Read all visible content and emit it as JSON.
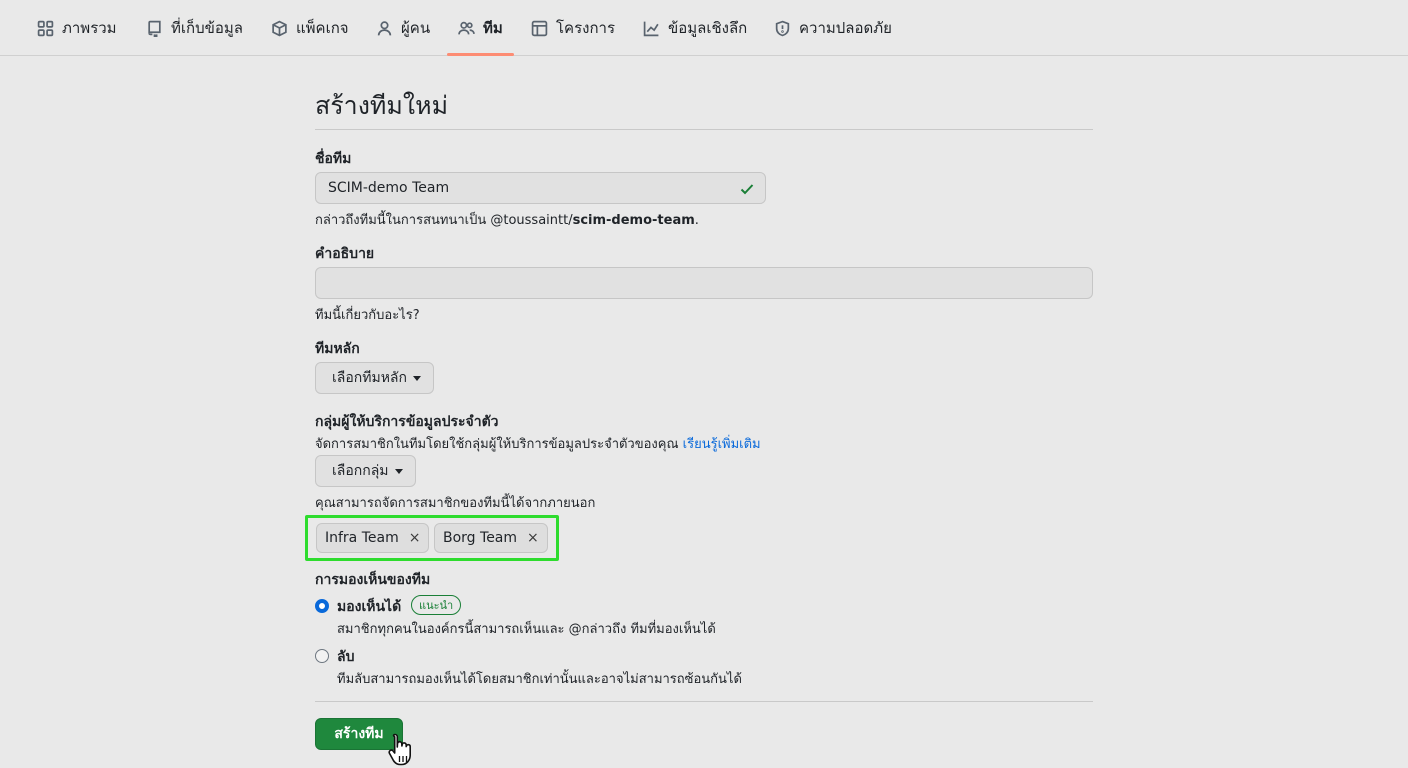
{
  "nav": {
    "tabs": [
      {
        "label": "ภาพรวม",
        "icon": "grid-icon"
      },
      {
        "label": "ที่เก็บข้อมูล",
        "icon": "repo-icon"
      },
      {
        "label": "แพ็คเกจ",
        "icon": "package-icon"
      },
      {
        "label": "ผู้คน",
        "icon": "person-icon"
      },
      {
        "label": "ทีม",
        "icon": "people-icon",
        "selected": true
      },
      {
        "label": "โครงการ",
        "icon": "table-icon"
      },
      {
        "label": "ข้อมูลเชิงลึก",
        "icon": "graph-icon"
      },
      {
        "label": "ความปลอดภัย",
        "icon": "shield-icon"
      }
    ],
    "selected_underline_color": "#fd8c73"
  },
  "page": {
    "title": "สร้างทีมใหม่"
  },
  "form": {
    "team_name": {
      "label": "ชื่อทีม",
      "value": "SCIM-demo Team",
      "hint_prefix": "กล่าวถึงทีมนี้ในการสนทนาเป็น @toussaintt/",
      "hint_handle": "scim-demo-team",
      "hint_suffix": "."
    },
    "description": {
      "label": "คำอธิบาย",
      "value": "",
      "hint": "ทีมนี้เกี่ยวกับอะไร?"
    },
    "parent_team": {
      "label": "ทีมหลัก",
      "button": "เลือกทีมหลัก"
    },
    "idp_group": {
      "label": "กลุ่มผู้ให้บริการข้อมูลประจำตัว",
      "hint": "จัดการสมาชิกในทีมโดยใช้กลุ่มผู้ให้บริการข้อมูลประจำตัวของคุณ ",
      "learn_more": "เรียนรู้เพิ่มเติม",
      "button": "เลือกกลุ่ม",
      "external_note": "คุณสามารถจัดการสมาชิกของทีมนี้ได้จากภายนอก",
      "selected_groups": [
        "Infra Team",
        "Borg Team"
      ],
      "remove_glyph": "×",
      "highlight_color": "#2edc2e"
    },
    "visibility": {
      "label": "การมองเห็นของทีม",
      "options": [
        {
          "title": "มองเห็นได้",
          "badge": "แนะนำ",
          "desc": "สมาชิกทุกคนในองค์กรนี้สามารถเห็นและ @กล่าวถึง ทีมที่มองเห็นได้",
          "selected": true
        },
        {
          "title": "ลับ",
          "desc": "ทีมลับสามารถมองเห็นได้โดยสมาชิกเท่านั้นและอาจไม่สามารถซ้อนกันได้",
          "selected": false
        }
      ]
    },
    "submit": "สร้างทีม",
    "submit_color": "#1f883d"
  }
}
